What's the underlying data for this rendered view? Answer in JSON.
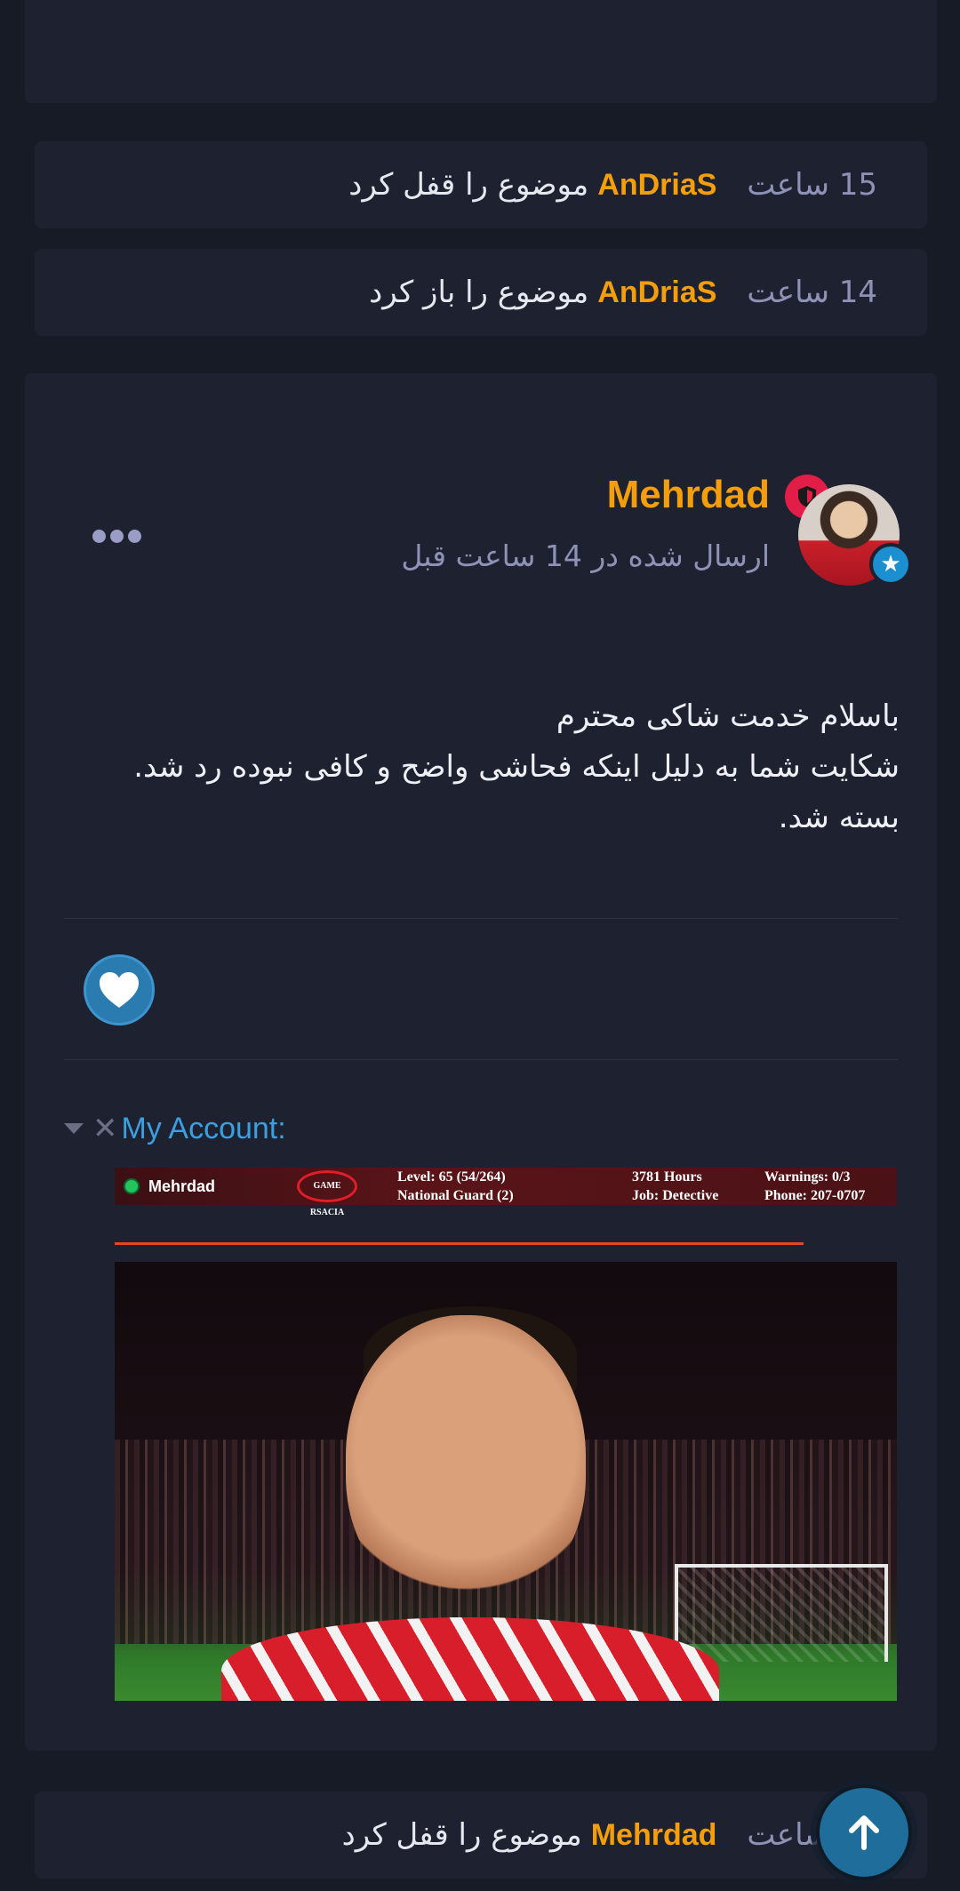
{
  "events": [
    {
      "time": "15 ساعت",
      "user": "AnDriaS",
      "action": "موضوع را قفل کرد"
    },
    {
      "time": "14 ساعت",
      "user": "AnDriaS",
      "action": "موضوع را باز کرد"
    }
  ],
  "post": {
    "author": "Mehrdad",
    "posted": "ارسال شده در 14 ساعت قبل",
    "body_lines": [
      "باسلام خدمت شاکی محترم",
      "شکایت شما به دلیل اینکه فحاشی واضح و کافی نبوده رد شد.",
      "بسته شد."
    ],
    "signature": {
      "title": "My Account:",
      "banner": {
        "name": "Mehrdad",
        "logo": "GAME RSACIA",
        "level": "Level: 65 (54/264)",
        "faction": "National Guard (2)",
        "hours": "3781 Hours",
        "job": "Job: Detective",
        "warnings": "Warnings: 0/3",
        "phone": "Phone: 207-0707"
      }
    }
  },
  "bottom_event": {
    "time": "14 ساعت",
    "user": "Mehrdad",
    "action": "موضوع را قفل کرد"
  },
  "icons": {
    "more": "more-horizontal-icon",
    "like": "heart-icon",
    "scroll_top": "arrow-up-icon",
    "badge_star": "star-icon",
    "badge_shield": "shield-icon"
  },
  "colors": {
    "accent_user": "#f59e0b",
    "muted": "#8e92b7",
    "link": "#3b9fe0",
    "card": "#1e2230",
    "background": "#171b26"
  }
}
